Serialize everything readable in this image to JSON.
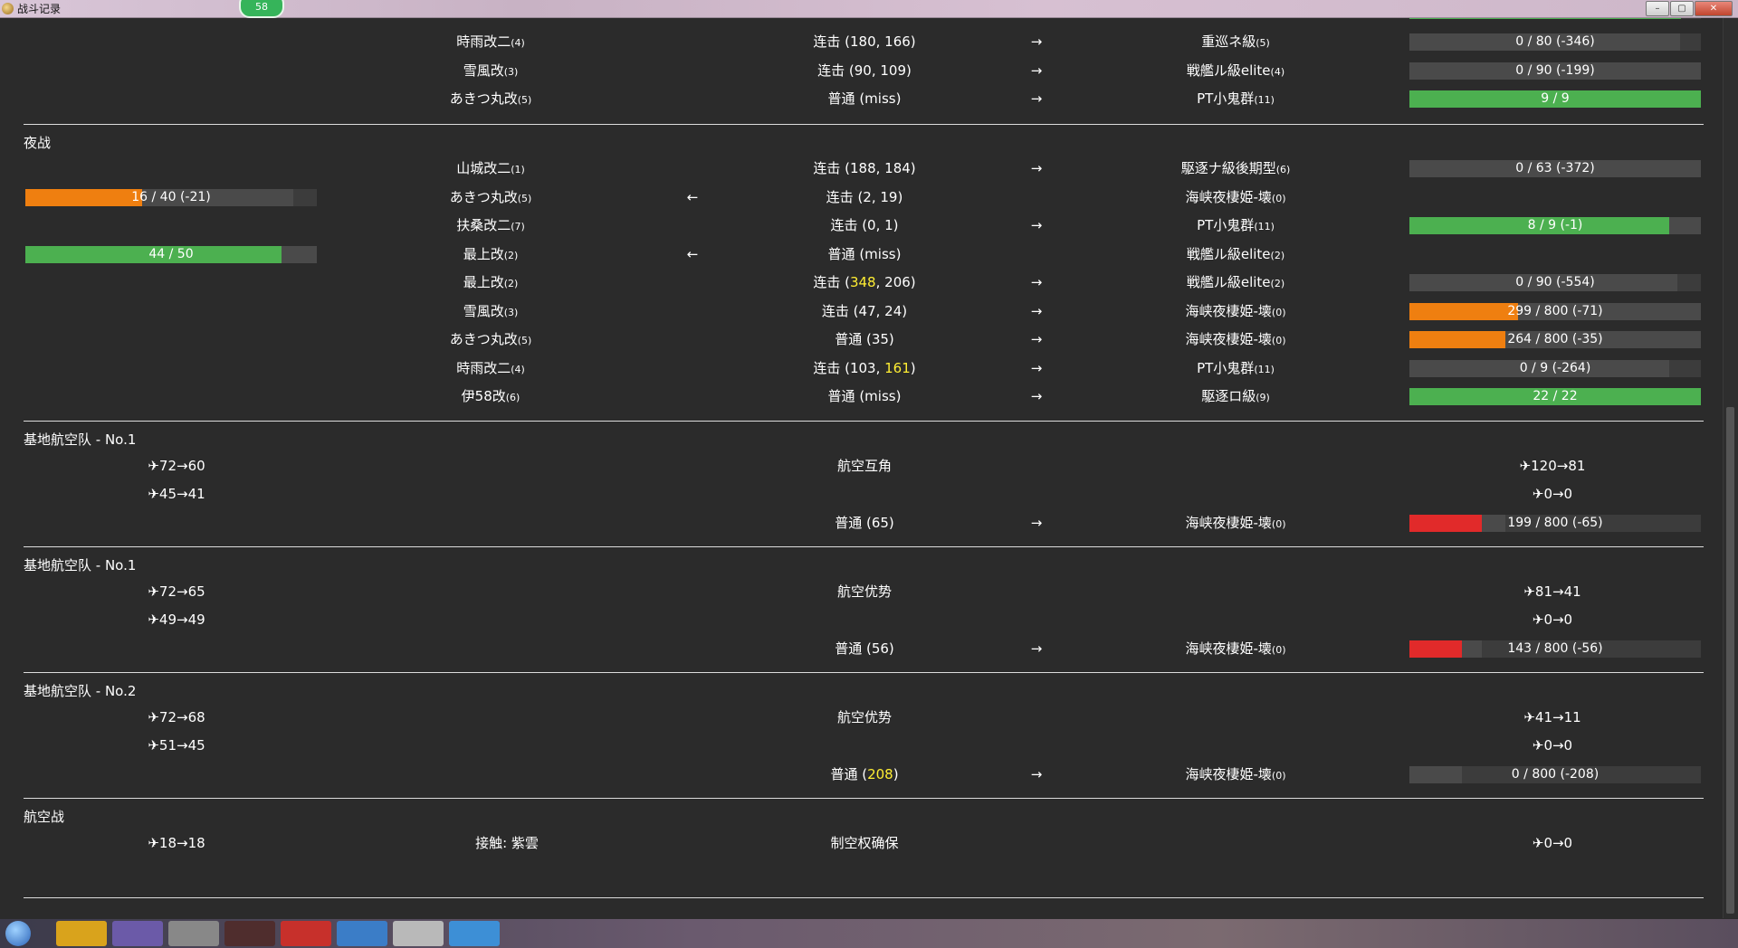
{
  "window": {
    "title": "战斗记录",
    "badge": "58",
    "minimize_icon": "minimize-icon",
    "maximize_icon": "maximize-icon",
    "close_icon": "close-icon"
  },
  "colors": {
    "background": "#2b2b2b",
    "green": "#4cb050",
    "orange": "#ef7f10",
    "red": "#e12a2a",
    "grey_bar": "#4a4a4a",
    "highlight": "#ffee33"
  },
  "sections": {
    "top_rows": [
      {
        "att": "時雨改二",
        "att_n": "(4)",
        "act": "连击 (180, 166)",
        "arrow": "→",
        "def": "重巡ネ級",
        "def_n": "(5)",
        "hp": "0 / 80 (-346)",
        "hp_fill": 0.0,
        "hp_color": "#4cb050",
        "hp_track": 0.93
      },
      {
        "att": "雪風改",
        "att_n": "(3)",
        "act": "连击 (90, 109)",
        "arrow": "→",
        "def": "戦艦ル級elite",
        "def_n": "(4)",
        "hp": "0 / 90 (-199)",
        "hp_fill": 0.0,
        "hp_color": "#4cb050",
        "hp_track": 1.0
      },
      {
        "att": "あきつ丸改",
        "att_n": "(5)",
        "act": "普通 (miss)",
        "arrow": "→",
        "def": "PT小鬼群",
        "def_n": "(11)",
        "hp": "9 / 9",
        "hp_fill": 1.0,
        "hp_color": "#4cb050",
        "hp_track": 1.0
      }
    ],
    "night_title": "夜战",
    "night_rows": [
      {
        "att": "山城改二",
        "att_n": "(1)",
        "act_pre": "连击 (",
        "act_hl": "",
        "act_post": "188, 184)",
        "arrow": "→",
        "def": "駆逐ナ級後期型",
        "def_n": "(6)",
        "hp": "0 / 63 (-372)",
        "hp_fill": 0.0,
        "hp_color": "#4cb050",
        "hp_track": 1.0
      },
      {
        "att": "あきつ丸改",
        "att_n": "(5)",
        "act_pre": "连击 (2, 19)",
        "act_hl": "",
        "act_post": "",
        "left_arrow": "←",
        "def": "海峡夜棲姫-壊",
        "def_n": "(0)",
        "left_hp": "16 / 40 (-21)",
        "left_fill": 0.4,
        "left_color": "#ef7f10",
        "left_track": 0.92
      },
      {
        "att": "扶桑改二",
        "att_n": "(7)",
        "act_pre": "连击 (0, 1)",
        "act_hl": "",
        "act_post": "",
        "arrow": "→",
        "def": "PT小鬼群",
        "def_n": "(11)",
        "hp": "8 / 9 (-1)",
        "hp_fill": 0.89,
        "hp_color": "#4cb050",
        "hp_track": 1.0
      },
      {
        "att": "最上改",
        "att_n": "(2)",
        "act_pre": "普通 (miss)",
        "act_hl": "",
        "act_post": "",
        "left_arrow": "←",
        "def": "戦艦ル級elite",
        "def_n": "(2)",
        "left_hp": "44 / 50",
        "left_fill": 0.88,
        "left_color": "#4cb050",
        "left_track": 1.0
      },
      {
        "att": "最上改",
        "att_n": "(2)",
        "act_pre": "连击 (",
        "act_hl": "348",
        "act_post": ", 206)",
        "arrow": "→",
        "def": "戦艦ル級elite",
        "def_n": "(2)",
        "hp": "0 / 90 (-554)",
        "hp_fill": 0.0,
        "hp_color": "#4cb050",
        "hp_track": 0.92
      },
      {
        "att": "雪風改",
        "att_n": "(3)",
        "act_pre": "连击 (47, 24)",
        "act_hl": "",
        "act_post": "",
        "arrow": "→",
        "def": "海峡夜棲姫-壊",
        "def_n": "(0)",
        "hp": "299 / 800 (-71)",
        "hp_fill": 0.374,
        "hp_color": "#ef7f10",
        "hp_track": 1.0
      },
      {
        "att": "あきつ丸改",
        "att_n": "(5)",
        "act_pre": "普通 (35)",
        "act_hl": "",
        "act_post": "",
        "arrow": "→",
        "def": "海峡夜棲姫-壊",
        "def_n": "(0)",
        "hp": "264 / 800 (-35)",
        "hp_fill": 0.33,
        "hp_color": "#ef7f10",
        "hp_track": 1.0
      },
      {
        "att": "時雨改二",
        "att_n": "(4)",
        "act_pre": "连击 (103, ",
        "act_hl": "161",
        "act_post": ")",
        "arrow": "→",
        "def": "PT小鬼群",
        "def_n": "(11)",
        "hp": "0 / 9 (-264)",
        "hp_fill": 0.0,
        "hp_color": "#4cb050",
        "hp_track": 0.89
      },
      {
        "att": "伊58改",
        "att_n": "(6)",
        "act_pre": "普通 (miss)",
        "act_hl": "",
        "act_post": "",
        "arrow": "→",
        "def": "駆逐ロ級",
        "def_n": "(9)",
        "hp": "22 / 22",
        "hp_fill": 1.0,
        "hp_color": "#4cb050",
        "hp_track": 1.0
      }
    ],
    "air1": {
      "title": "基地航空队 - No.1",
      "l1": "✈72→60",
      "mid": "航空互角",
      "r1": "✈120→81",
      "l2": "✈45→41",
      "r2": "✈0→0",
      "act_pre": "普通 (65)",
      "act_hl": "",
      "act_post": "",
      "arrow": "→",
      "def": "海峡夜棲姫-壊",
      "def_n": "(0)",
      "hp": "199 / 800 (-65)",
      "hp_fill": 0.249,
      "hp_color": "#e12a2a",
      "hp_track": 0.33
    },
    "air2": {
      "title": "基地航空队 - No.1",
      "l1": "✈72→65",
      "mid": "航空优势",
      "r1": "✈81→41",
      "l2": "✈49→49",
      "r2": "✈0→0",
      "act_pre": "普通 (56)",
      "act_hl": "",
      "act_post": "",
      "arrow": "→",
      "def": "海峡夜棲姫-壊",
      "def_n": "(0)",
      "hp": "143 / 800 (-56)",
      "hp_fill": 0.179,
      "hp_color": "#e12a2a",
      "hp_track": 0.249
    },
    "air3": {
      "title": "基地航空队 - No.2",
      "l1": "✈72→68",
      "mid": "航空优势",
      "r1": "✈41→11",
      "l2": "✈51→45",
      "r2": "✈0→0",
      "act_pre": "普通 (",
      "act_hl": "208",
      "act_post": ")",
      "arrow": "→",
      "def": "海峡夜棲姫-壊",
      "def_n": "(0)",
      "hp": "0 / 800 (-208)",
      "hp_fill": 0.0,
      "hp_color": "#e12a2a",
      "hp_track": 0.179
    },
    "airbattle": {
      "title": "航空战",
      "l1": "✈18→18",
      "contact": "接触: 紫雲",
      "mid": "制空权确保",
      "r1": "✈0→0"
    }
  }
}
